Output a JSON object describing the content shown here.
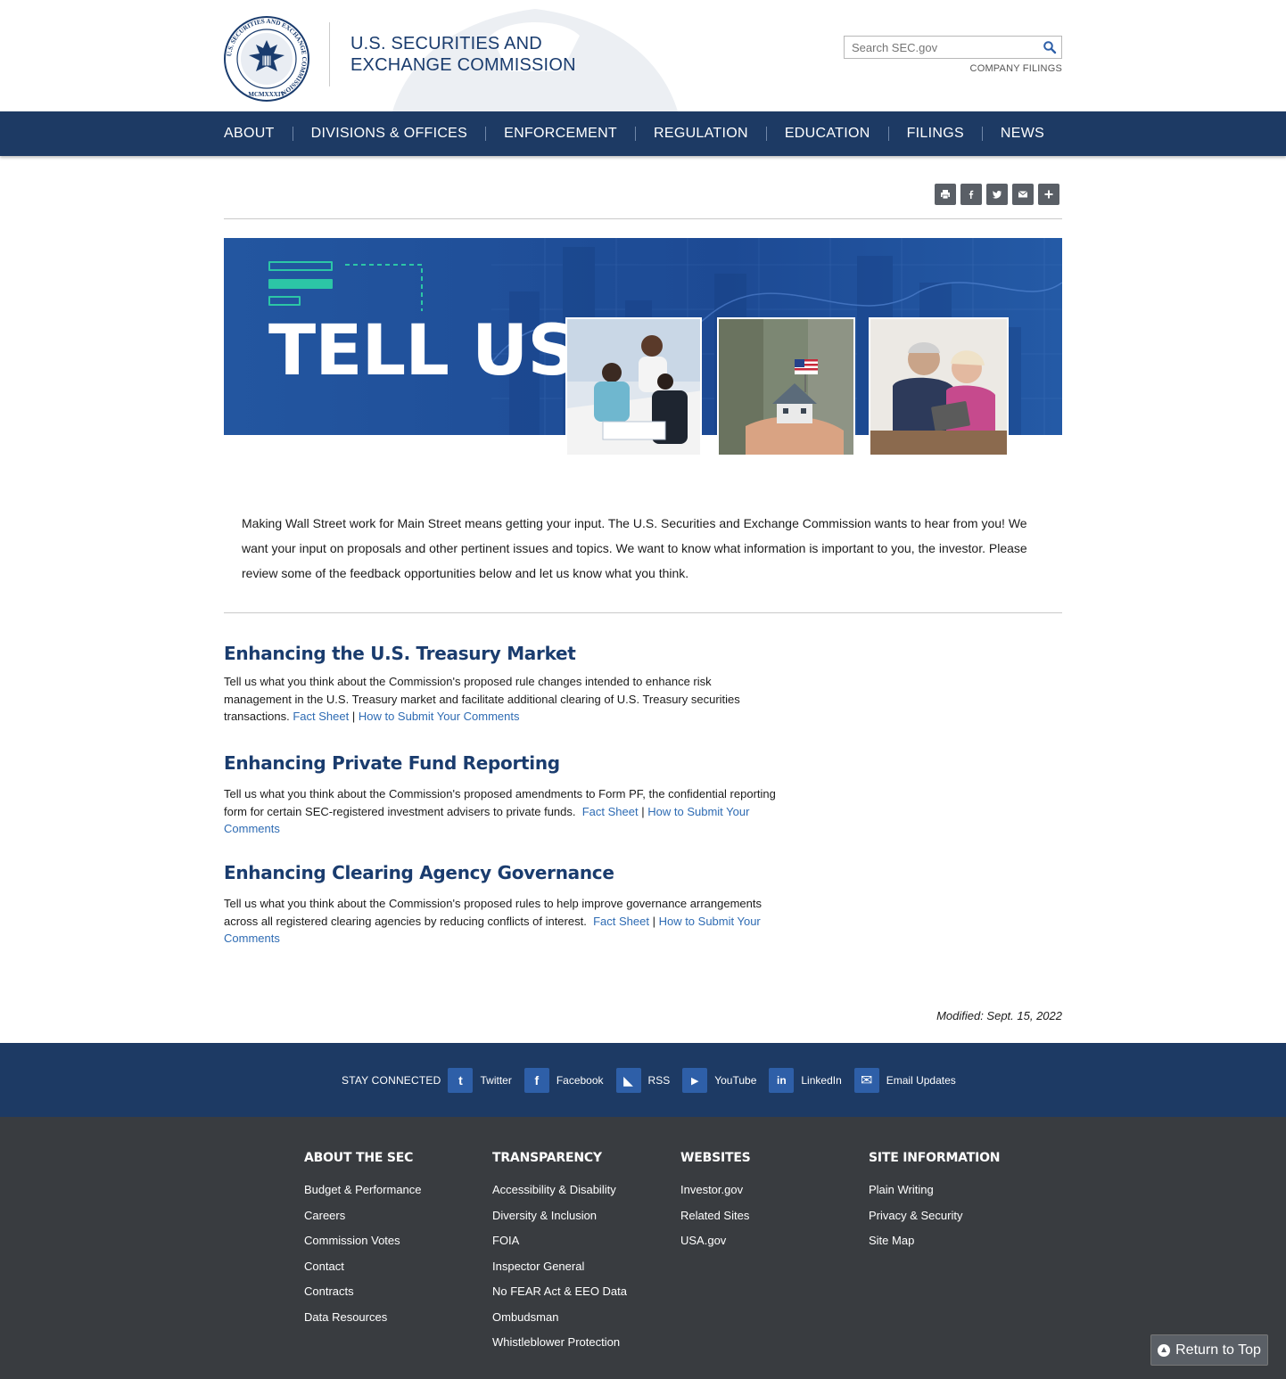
{
  "header": {
    "agency_line1": "U.S. SECURITIES AND",
    "agency_line2": "EXCHANGE COMMISSION",
    "seal_text": "U.S. SECURITIES AND EXCHANGE COMMISSION",
    "seal_year": "MCMXXXIV",
    "search_placeholder": "Search SEC.gov",
    "company_filings": "COMPANY FILINGS"
  },
  "nav": {
    "items": [
      "ABOUT",
      "DIVISIONS & OFFICES",
      "ENFORCEMENT",
      "REGULATION",
      "EDUCATION",
      "FILINGS",
      "NEWS"
    ]
  },
  "share": {
    "icons": [
      "print-icon",
      "facebook-icon",
      "twitter-icon",
      "email-icon",
      "plus-icon"
    ]
  },
  "banner": {
    "title": "TELL US"
  },
  "intro": "Making Wall Street work for Main Street means getting your input. The U.S. Securities and Exchange Commission wants to hear from you! We want your input on proposals and other pertinent issues and topics. We want to know what information is important to you, the investor. Please review some of the feedback opportunities below and let us know what you think.",
  "sections": [
    {
      "title": "Enhancing the U.S. Treasury Market",
      "body": "Tell us what you think about the Commission's proposed rule changes intended to enhance risk management in the U.S. Treasury market and facilitate additional clearing of U.S. Treasury securities transactions.",
      "link1": "Fact Sheet",
      "separator": "|",
      "link2": "How to Submit Your Comments"
    },
    {
      "title": "Enhancing Private Fund Reporting",
      "body": "Tell us what you think about the Commission's proposed amendments to Form PF, the confidential reporting form for certain SEC-registered investment advisers to private funds.",
      "link1": "Fact Sheet",
      "separator": "|",
      "link2": "How to Submit Your Comments"
    },
    {
      "title": "Enhancing Clearing Agency Governance",
      "body": "Tell us what you think about the Commission's proposed rules to help improve governance arrangements across all registered clearing agencies by reducing conflicts of interest.",
      "link1": "Fact Sheet",
      "separator": "|",
      "link2": "How to Submit Your Comments"
    }
  ],
  "modified": "Modified: Sept. 15, 2022",
  "connected": {
    "label": "STAY CONNECTED",
    "items": [
      {
        "icon": "twitter-icon",
        "glyph": "t",
        "label": "Twitter"
      },
      {
        "icon": "facebook-icon",
        "glyph": "f",
        "label": "Facebook"
      },
      {
        "icon": "rss-icon",
        "glyph": "◣",
        "label": "RSS"
      },
      {
        "icon": "youtube-icon",
        "glyph": "▶",
        "label": "YouTube"
      },
      {
        "icon": "linkedin-icon",
        "glyph": "in",
        "label": "LinkedIn"
      },
      {
        "icon": "email-icon",
        "glyph": "✉",
        "label": "Email Updates"
      }
    ]
  },
  "footer": {
    "columns": [
      {
        "title": "ABOUT THE SEC",
        "links": [
          "Budget & Performance",
          "Careers",
          "Commission Votes",
          "Contact",
          "Contracts",
          "Data Resources"
        ]
      },
      {
        "title": "TRANSPARENCY",
        "links": [
          "Accessibility & Disability",
          "Diversity & Inclusion",
          "FOIA",
          "Inspector General",
          "No FEAR Act & EEO Data",
          "Ombudsman",
          "Whistleblower Protection"
        ]
      },
      {
        "title": "WEBSITES",
        "links": [
          "Investor.gov",
          "Related Sites",
          "USA.gov"
        ]
      },
      {
        "title": "SITE INFORMATION",
        "links": [
          "Plain Writing",
          "Privacy & Security",
          "Site Map"
        ]
      }
    ]
  },
  "return_top": "Return to Top",
  "colors": {
    "navy": "#1d3a64",
    "heading_blue": "#1a3c6e",
    "link_blue": "#2e6bb3",
    "footer_gray": "#393c40",
    "banner_blue": "#2356a0"
  }
}
